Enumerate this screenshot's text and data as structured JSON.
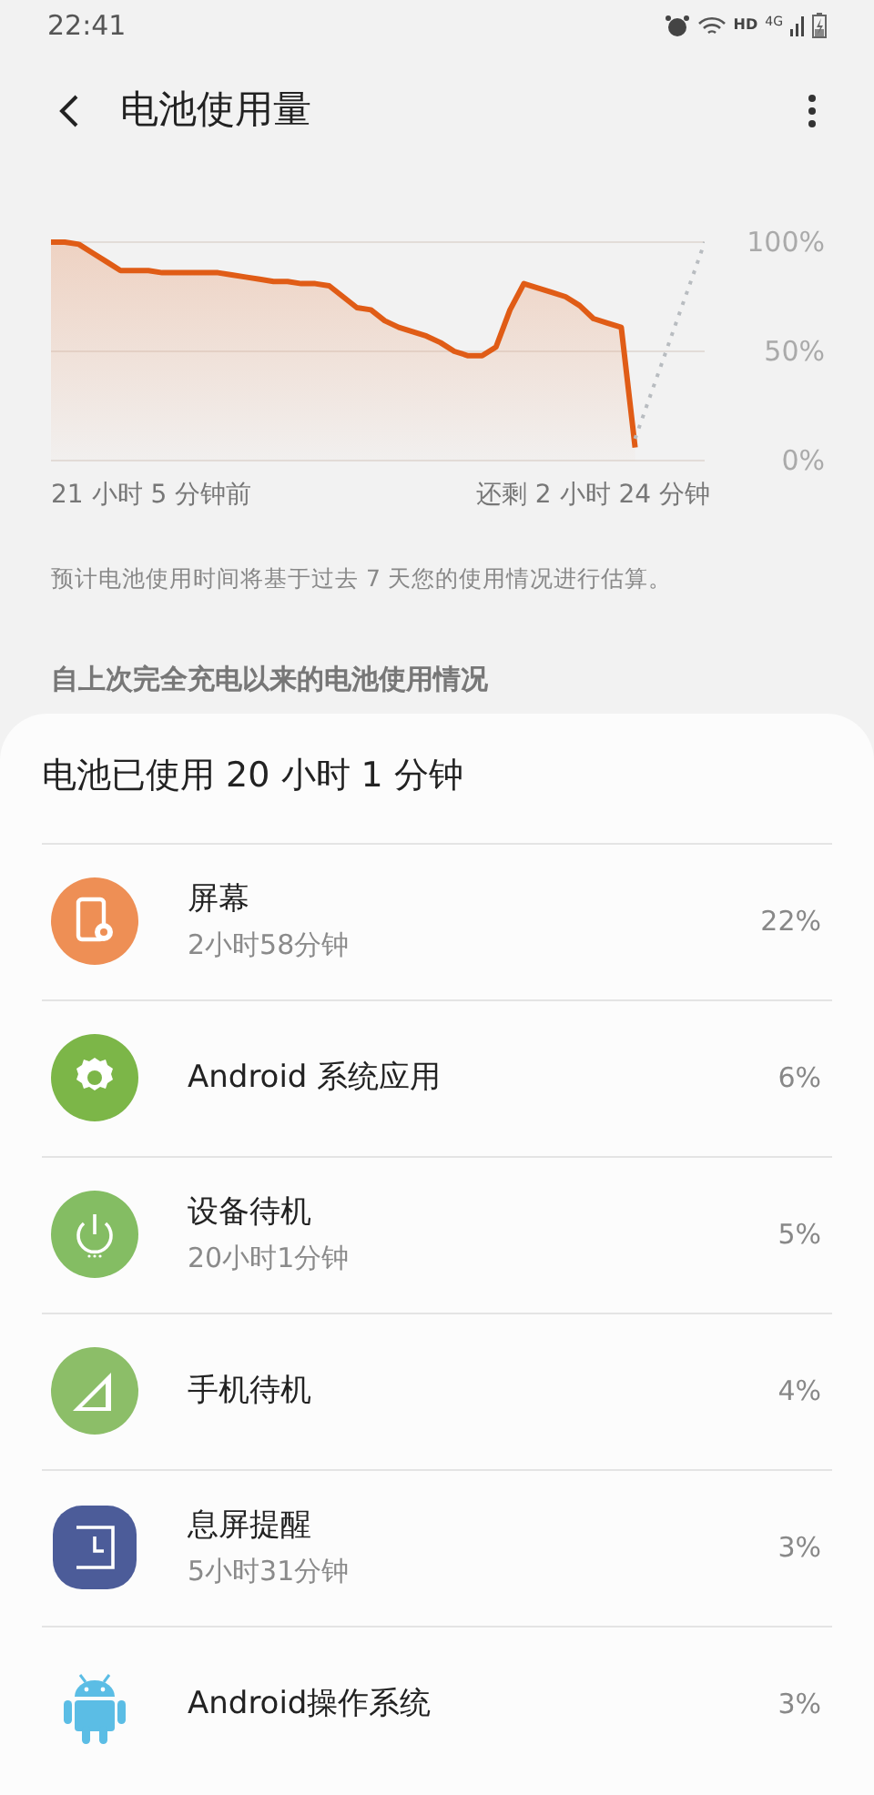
{
  "status_bar": {
    "time": "22:41",
    "hd": "HD",
    "network": "4G"
  },
  "header": {
    "title": "电池使用量"
  },
  "chart": {
    "start_label": "21 小时 5 分钟前",
    "end_label": "还剩 2 小时 24 分钟",
    "chart_data": {
      "type": "area",
      "categories": [
        null,
        null,
        null,
        null,
        null,
        null,
        null,
        null,
        null,
        null,
        null,
        null,
        null,
        null,
        null,
        null,
        null,
        null,
        null,
        null,
        null,
        null,
        null,
        null,
        null,
        null,
        null,
        null,
        null,
        null,
        null,
        null,
        null,
        null,
        null,
        null,
        null,
        null,
        null,
        null,
        null,
        null,
        null,
        null,
        null,
        null,
        null,
        null
      ],
      "series": [
        {
          "color": "#e05c16",
          "type": "area",
          "line_style": "solid",
          "values": [
            100,
            100,
            99,
            95,
            91,
            87,
            87,
            87,
            86,
            86,
            86,
            86,
            86,
            85,
            84,
            83,
            82,
            82,
            81,
            81,
            80,
            75,
            70,
            69,
            64,
            61,
            59,
            57,
            54,
            50,
            48,
            48,
            52,
            69,
            81,
            79,
            77,
            75,
            71,
            65,
            63,
            61,
            6,
            null,
            null,
            null,
            null,
            null
          ]
        },
        {
          "color": "#b8bcc0",
          "type": "line",
          "line_style": "dashed",
          "values": [
            null,
            null,
            null,
            null,
            null,
            null,
            null,
            null,
            null,
            null,
            null,
            null,
            null,
            null,
            null,
            null,
            null,
            null,
            null,
            null,
            null,
            null,
            null,
            null,
            null,
            null,
            null,
            null,
            null,
            null,
            null,
            null,
            null,
            null,
            null,
            null,
            null,
            null,
            null,
            null,
            null,
            null,
            10,
            28,
            46,
            64,
            82,
            100
          ]
        }
      ],
      "ylim": [
        0,
        100
      ],
      "yticks": [
        {
          "value": 100,
          "label": "100%"
        },
        {
          "value": 50,
          "label": "50%"
        },
        {
          "value": 0,
          "label": "0%"
        }
      ]
    }
  },
  "note": "预计电池使用时间将基于过去 7 天您的使用情况进行估算。",
  "section_title": "自上次完全充电以来的电池使用情况",
  "usage": {
    "title": "电池已使用 20 小时 1 分钟",
    "items": [
      {
        "name": "屏幕",
        "detail": "2小时58分钟",
        "percent": "22%"
      },
      {
        "name": "Android 系统应用",
        "percent": "6%"
      },
      {
        "name": "设备待机",
        "detail": "20小时1分钟",
        "percent": "5%"
      },
      {
        "name": "手机待机",
        "percent": "4%"
      },
      {
        "name": "息屏提醒",
        "detail": "5小时31分钟",
        "percent": "3%"
      },
      {
        "name": "Android操作系统",
        "percent": "3%"
      }
    ]
  }
}
